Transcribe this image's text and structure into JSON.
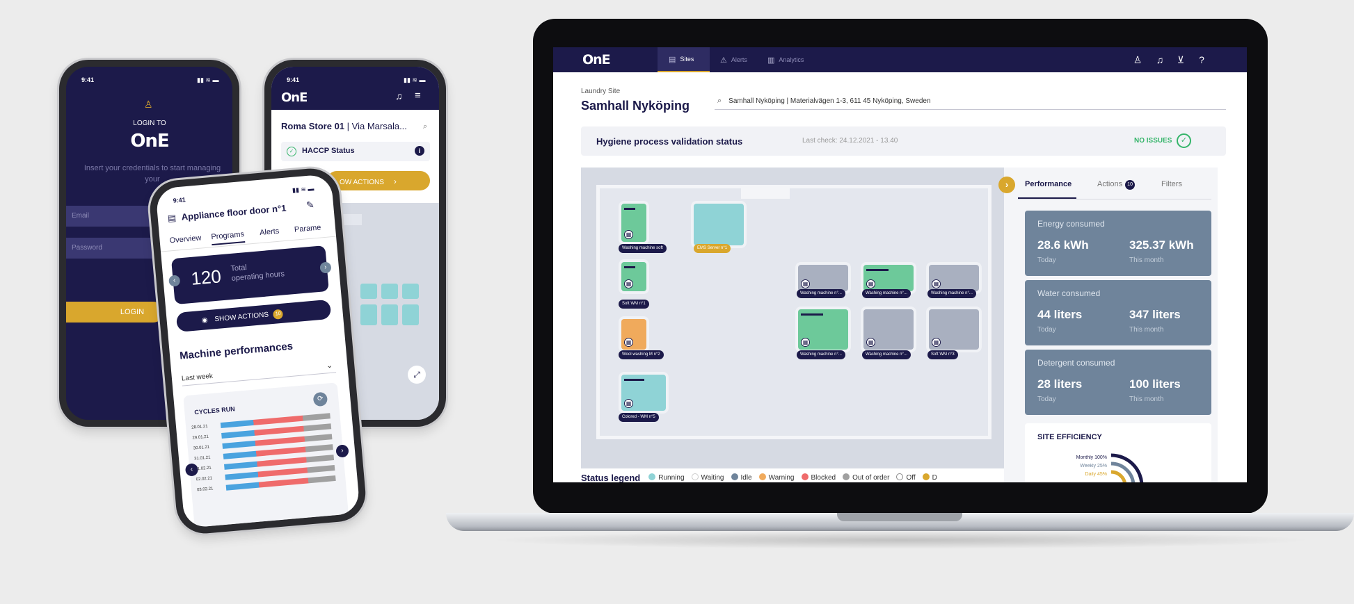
{
  "laptop": {
    "logo": "OnE",
    "nav": [
      {
        "label": "Sites",
        "icon": "building-icon"
      },
      {
        "label": "Alerts",
        "icon": "warning-icon"
      },
      {
        "label": "Analytics",
        "icon": "chart-icon"
      }
    ],
    "header_icons": [
      "user-icon",
      "bell-icon",
      "cart-icon",
      "help-icon"
    ],
    "site_type": "Laundry Site",
    "site_name": "Samhall Nyköping",
    "search_value": "Samhall Nyköping | Materialvägen 1-3, 611 45 Nyköping, Sweden",
    "validation": {
      "title": "Hygiene process validation status",
      "last_check": "Last check: 24.12.2021 - 13.40",
      "status": "NO ISSUES"
    },
    "machines": [
      {
        "label": "Washing machine soft",
        "status": "running"
      },
      {
        "label": "EMS Server n°1",
        "status": "server"
      },
      {
        "label": "Soft WM n°1",
        "status": "running"
      },
      {
        "label": "Wool washing M n°2",
        "status": "warning"
      },
      {
        "label": "Colored - WM n°5",
        "status": "running"
      },
      {
        "label": "Washing machine n°...",
        "status": "idle"
      },
      {
        "label": "Washing machine n°...",
        "status": "running"
      },
      {
        "label": "Washing machine n°...",
        "status": "idle"
      },
      {
        "label": "Washing machine n°...",
        "status": "running"
      },
      {
        "label": "Washing machine n°...",
        "status": "idle"
      },
      {
        "label": "Soft WM n°3",
        "status": "idle"
      }
    ],
    "legend": {
      "title": "Status legend",
      "items": [
        {
          "label": "Running",
          "color": "#8fd3d6"
        },
        {
          "label": "Waiting",
          "color": "#ffffff"
        },
        {
          "label": "Idle",
          "color": "#6f849b"
        },
        {
          "label": "Warning",
          "color": "#f0aa5c"
        },
        {
          "label": "Blocked",
          "color": "#ef6b6b"
        },
        {
          "label": "Out of order",
          "color": "#a0a0a0"
        },
        {
          "label": "Off",
          "color": "#ffffff"
        },
        {
          "label": "D",
          "color": "#d9a72d"
        }
      ]
    },
    "panel": {
      "tabs": [
        "Performance",
        "Actions",
        "Filters"
      ],
      "actions_count": "10",
      "cards": [
        {
          "title": "Energy consumed",
          "today": "28.6 kWh",
          "month": "325.37 kWh",
          "today_label": "Today",
          "month_label": "This month"
        },
        {
          "title": "Water consumed",
          "today": "44 liters",
          "month": "347 liters",
          "today_label": "Today",
          "month_label": "This month"
        },
        {
          "title": "Detergent consumed",
          "today": "28 liters",
          "month": "100 liters",
          "today_label": "Today",
          "month_label": "This month"
        }
      ],
      "efficiency": {
        "title": "SITE EFFICIENCY",
        "rows": [
          {
            "label": "Monthly 100%",
            "value": 100,
            "color": "#1c1a4a"
          },
          {
            "label": "Weekly 25%",
            "value": 25,
            "color": "#6f849b"
          },
          {
            "label": "Daily 45%",
            "value": 45,
            "color": "#d9a72d"
          }
        ]
      }
    }
  },
  "phone_login": {
    "time": "9:41",
    "login_to": "LOGIN TO",
    "logo": "OnE",
    "hint": "Insert your credentials to start managing your",
    "email_placeholder": "Email",
    "password_placeholder": "Password",
    "login_button": "LOGIN"
  },
  "phone_store": {
    "time": "9:41",
    "logo": "OnE",
    "store": "Roma Store 01",
    "store_address": "| Via Marsala...",
    "haccp": "HACCP Status",
    "actions_button": "OW ACTIONS"
  },
  "phone_appliance": {
    "time": "9:41",
    "title": "Appliance floor door n°1",
    "tabs": [
      "Overview",
      "Programs",
      "Alerts",
      "Parame"
    ],
    "hours_value": "120",
    "hours_label_1": "Total",
    "hours_label_2": "operating hours",
    "show_actions": "SHOW ACTIONS",
    "actions_count": "10",
    "perf_title": "Machine performances",
    "period": "Last week",
    "cycles_title": "CYCLES RUN",
    "cycles_dates": [
      "28.01.21",
      "29.01.21",
      "30.01.21",
      "31.01.21",
      "01.02.21",
      "02.02.21",
      "03.02.21"
    ]
  }
}
